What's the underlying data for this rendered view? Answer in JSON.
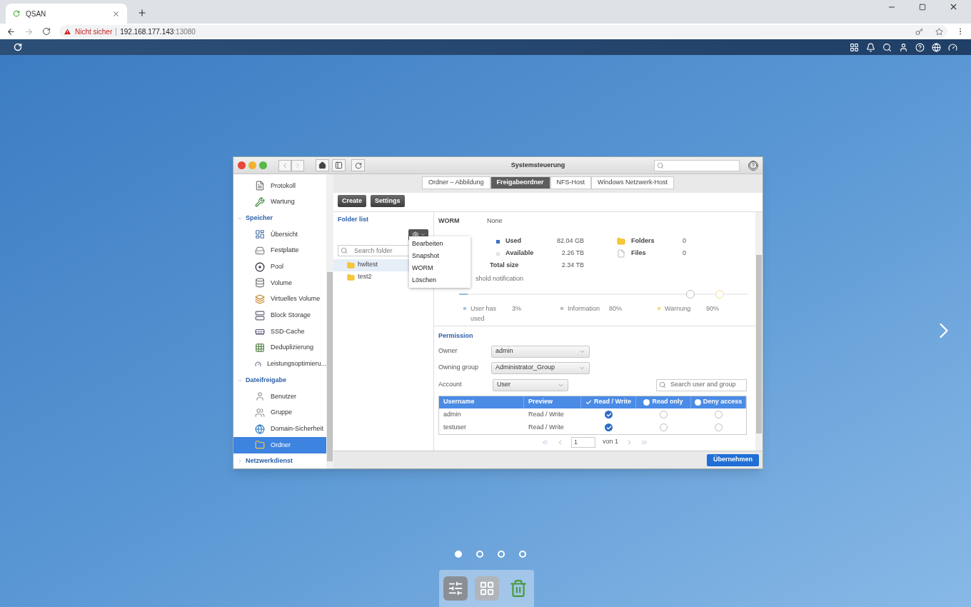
{
  "browser": {
    "tab_title": "QSAN",
    "security_warning": "Nicht sicher",
    "host": "192.168.177.143",
    "port": ":13080"
  },
  "window": {
    "title": "Systemsteuerung"
  },
  "sidebar": {
    "leading_items": [
      {
        "label": "Protokoll",
        "selected": false
      },
      {
        "label": "Wartung",
        "selected": false
      }
    ],
    "groups": [
      {
        "label": "Speicher",
        "expanded": true,
        "children": [
          {
            "label": "Übersicht",
            "selected": false
          },
          {
            "label": "Festplatte",
            "selected": false
          },
          {
            "label": "Pool",
            "selected": false
          },
          {
            "label": "Volume",
            "selected": false
          },
          {
            "label": "Virtuelles Volume",
            "selected": false
          },
          {
            "label": "Block Storage",
            "selected": false
          },
          {
            "label": "SSD-Cache",
            "selected": false
          },
          {
            "label": "Deduplizierung",
            "selected": false
          },
          {
            "label": "Leistungsoptimieru...",
            "selected": false
          }
        ]
      },
      {
        "label": "Dateifreigabe",
        "expanded": true,
        "children": [
          {
            "label": "Benutzer",
            "selected": false
          },
          {
            "label": "Gruppe",
            "selected": false
          },
          {
            "label": "Domain-Sicherheit",
            "selected": false
          },
          {
            "label": "Ordner",
            "selected": true
          }
        ]
      },
      {
        "label": "Netzwerkdienst",
        "expanded": false
      }
    ]
  },
  "tabs": [
    {
      "label": "Ordner – Abbildung",
      "selected": false
    },
    {
      "label": "Freigabeordner",
      "selected": true
    },
    {
      "label": "NFS-Host",
      "selected": false
    },
    {
      "label": "Windows Netzwerk-Host",
      "selected": false
    }
  ],
  "toolbar": [
    "Create",
    "Settings"
  ],
  "folder_list": {
    "title": "Folder list",
    "search_placeholder": "Search folder",
    "folders": [
      {
        "name": "hwltest",
        "selected": true
      },
      {
        "name": "test2",
        "selected": false
      }
    ],
    "action_menu": [
      "Bearbeiten",
      "Snapshot",
      "WORM",
      "Löschen"
    ]
  },
  "details": {
    "worm": {
      "label": "WORM",
      "value": "None"
    },
    "usage": [
      {
        "label": "Used",
        "value": "82.04 GB",
        "color": "#3a6fc4"
      },
      {
        "label": "Available",
        "value": "2.26 TB",
        "color": "#e4e4e4"
      },
      {
        "label": "Total size",
        "value": "2.34 TB"
      }
    ],
    "counts": [
      {
        "label": "Folders",
        "value": "0"
      },
      {
        "label": "Files",
        "value": "0"
      }
    ],
    "threshold": {
      "label": "shold notification",
      "disabled": true,
      "used": {
        "level": 0.03
      },
      "marks": [
        {
          "level": 0.8,
          "color": "#bdbdbd"
        },
        {
          "level": 0.9,
          "color": "#f3dc8a"
        }
      ],
      "legend": [
        {
          "label": "User has used",
          "value": "3%",
          "color": "#a9c3e8"
        },
        {
          "label": "Information",
          "value": "80%",
          "color": "#bdbdbd"
        },
        {
          "label": "Warnung",
          "value": "90%",
          "color": "#f3dc8a"
        }
      ]
    }
  },
  "permission": {
    "title": "Permission",
    "owner": {
      "label": "Owner",
      "value": "admin"
    },
    "owning_group": {
      "label": "Owning group",
      "value": "Administrator_Group"
    },
    "account": {
      "label": "Account",
      "value": "User"
    },
    "search_placeholder": "Search user and group",
    "columns": [
      {
        "label": "Username"
      },
      {
        "label": "Preview"
      },
      {
        "label": "Read / Write",
        "checked": true
      },
      {
        "label": "Read only",
        "checked": false
      },
      {
        "label": "Deny access",
        "checked": false
      }
    ],
    "rows": [
      {
        "username": "admin",
        "preview": "Read / Write",
        "read_write": true,
        "read_only": false,
        "deny": false
      },
      {
        "username": "testuser",
        "preview": "Read / Write",
        "read_write": true,
        "read_only": false,
        "deny": false
      }
    ],
    "pagination": {
      "page": "1",
      "of": "von 1"
    }
  },
  "footer_button": "Übernehmen",
  "desktop": {
    "pages": [
      {
        "selected": true
      },
      {
        "selected": false
      },
      {
        "selected": false
      },
      {
        "selected": false
      }
    ]
  }
}
